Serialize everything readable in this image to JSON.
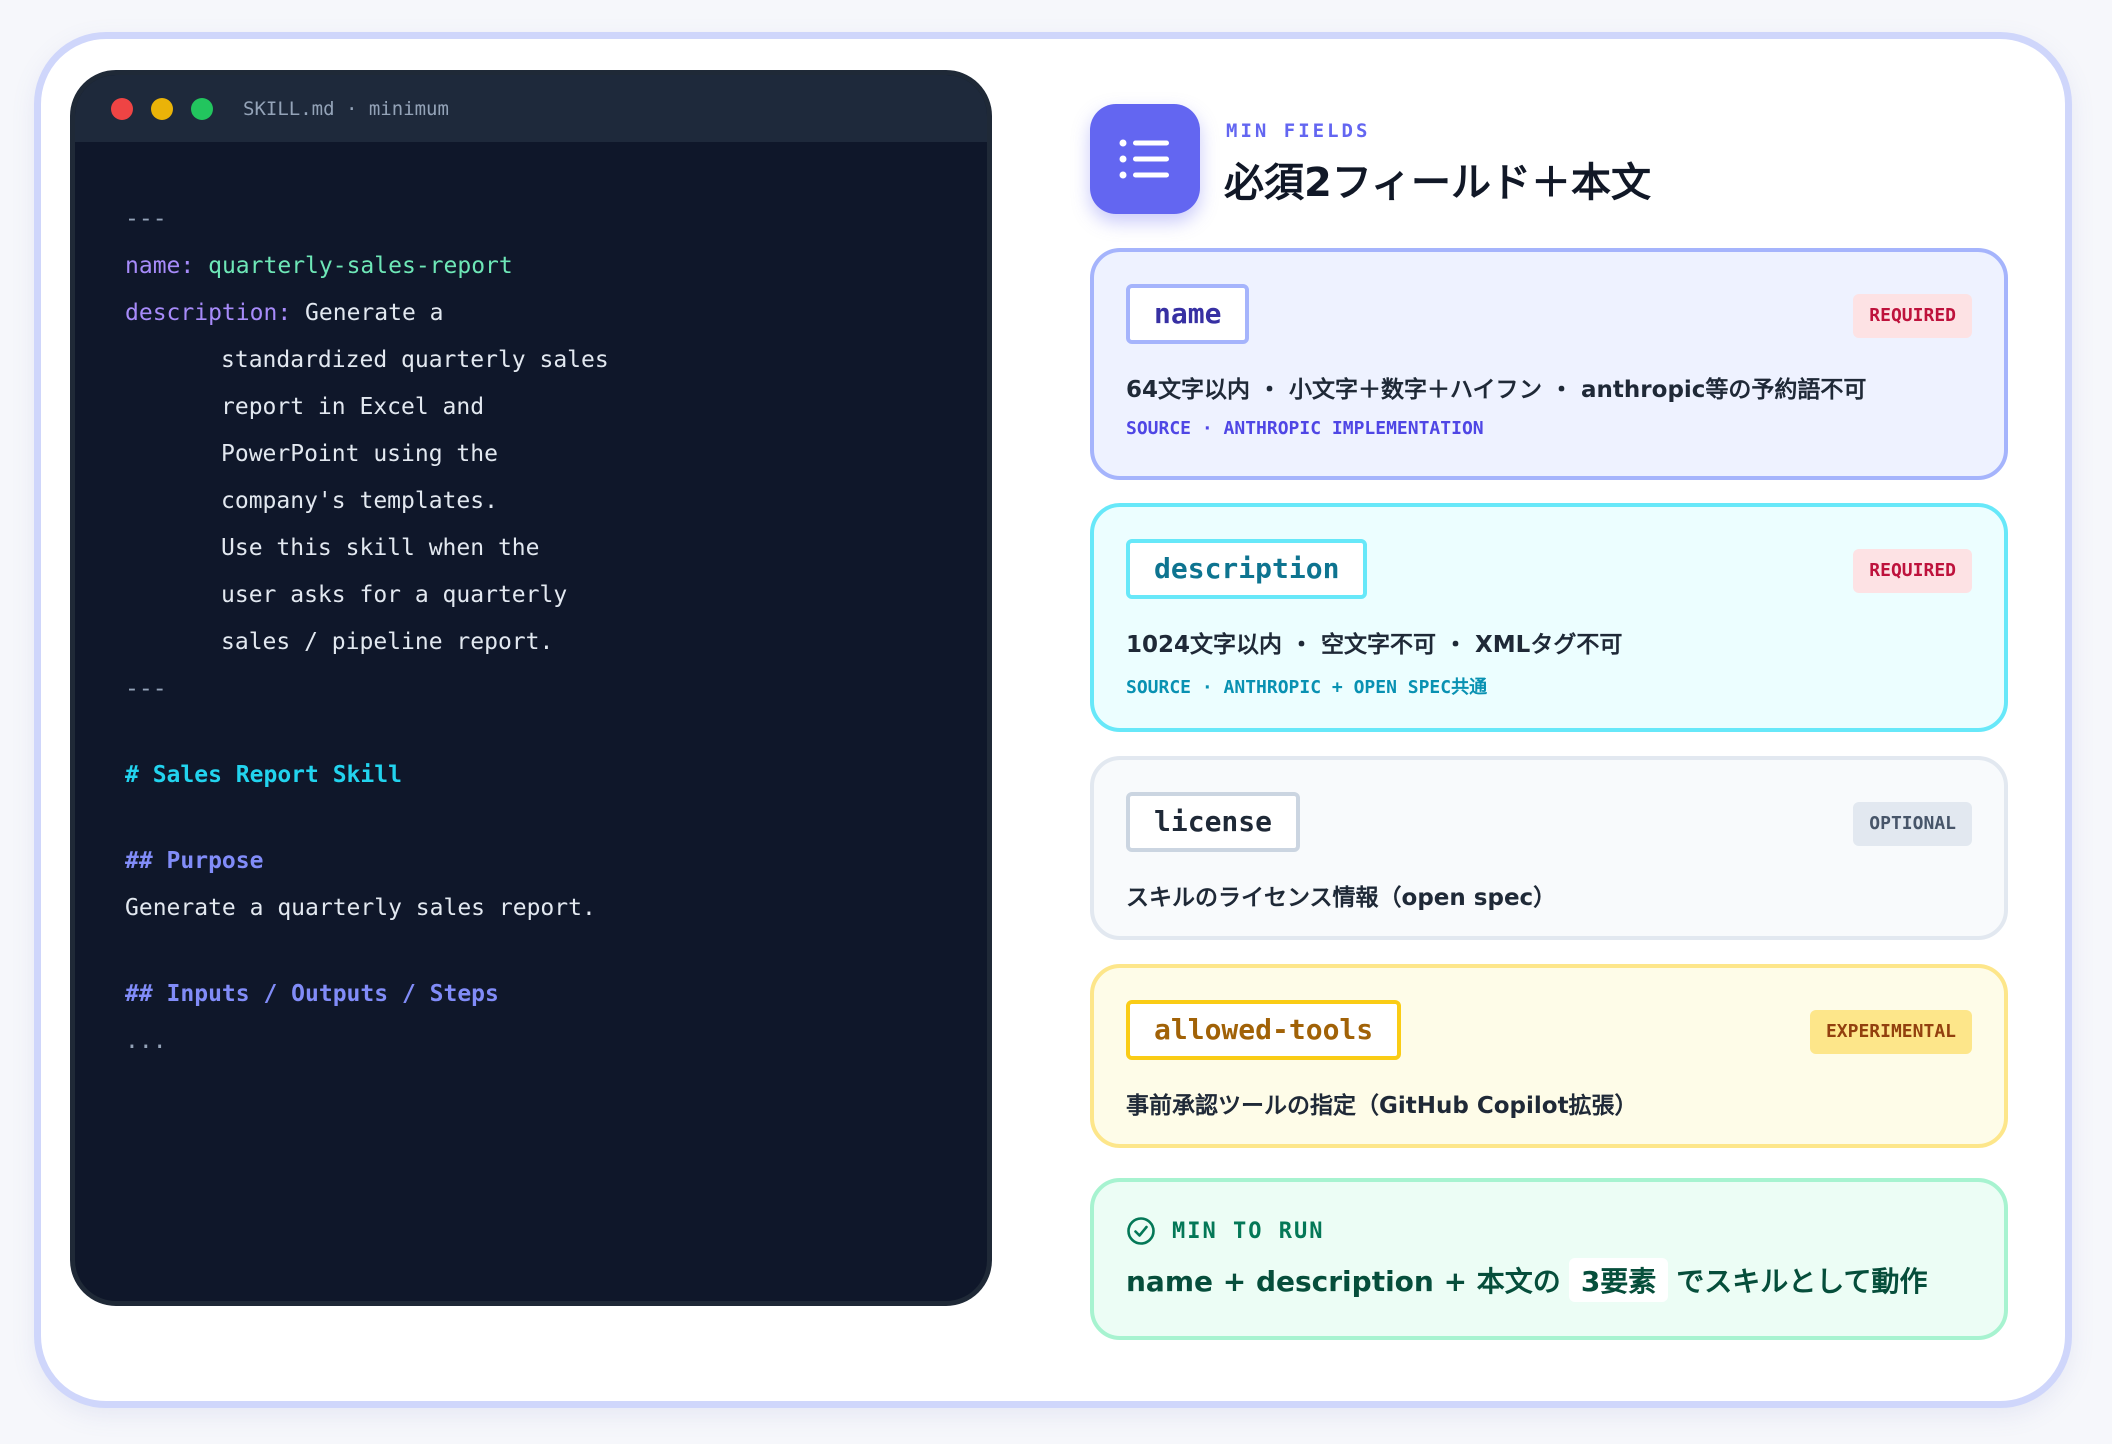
{
  "editor": {
    "window_title": "SKILL.md · minimum",
    "lines": {
      "l1": "---",
      "l2_key": "name:",
      "l2_val": "quarterly-sales-report",
      "l3_key": "description:",
      "l3_val": "Generate a",
      "l4": "standardized quarterly sales",
      "l5": "report in Excel and",
      "l6": "PowerPoint using the",
      "l7": "company's templates.",
      "l8": "Use this skill when the",
      "l9": "user asks for a quarterly",
      "l10": "sales / pipeline report.",
      "l11": "---",
      "l12": "# Sales Report Skill",
      "l13": "## Purpose",
      "l14": "Generate a quarterly sales report.",
      "l15": "## Inputs / Outputs / Steps",
      "l16": "..."
    }
  },
  "header": {
    "icon": "list-icon",
    "eyebrow": "MIN FIELDS",
    "title": "必須2フィールド＋本文"
  },
  "fields": {
    "name": {
      "tag": "name",
      "badge": "REQUIRED",
      "description": "64文字以内 ・ 小文字＋数字＋ハイフン ・ anthropic等の予約語不可",
      "source": "SOURCE · ANTHROPIC IMPLEMENTATION"
    },
    "description": {
      "tag": "description",
      "badge": "REQUIRED",
      "description": "1024文字以内 ・ 空文字不可 ・ XMLタグ不可",
      "source": "SOURCE · ANTHROPIC + OPEN SPEC共通"
    },
    "license": {
      "tag": "license",
      "badge": "OPTIONAL",
      "description": "スキルのライセンス情報（open spec）"
    },
    "allowed_tools": {
      "tag": "allowed-tools",
      "badge": "EXPERIMENTAL",
      "description": "事前承認ツールの指定（GitHub Copilot拡張）"
    }
  },
  "min_to_run": {
    "icon": "check-circle-icon",
    "label": "MIN TO RUN",
    "prefix": "name + description + 本文の",
    "highlight": "3要素",
    "suffix": "でスキルとして動作"
  },
  "colors": {
    "accent": "#6366f1",
    "editor_bg": "#0f172a",
    "success": "#047857"
  }
}
